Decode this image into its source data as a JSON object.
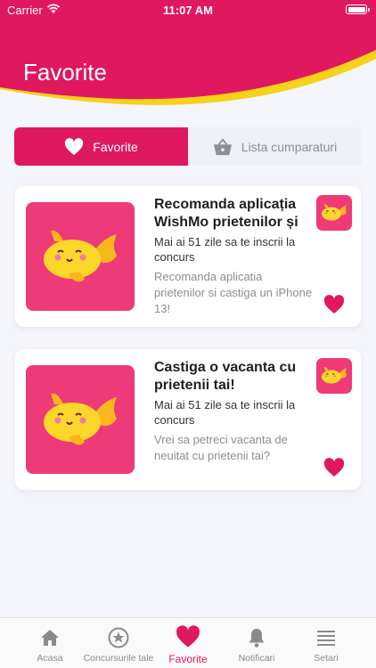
{
  "status_bar": {
    "carrier": "Carrier",
    "time": "11:07 AM"
  },
  "header": {
    "title": "Favorite"
  },
  "segments": [
    {
      "label": "Favorite",
      "icon": "heart-icon",
      "active": true
    },
    {
      "label": "Lista cumparaturi",
      "icon": "basket-icon",
      "active": false
    }
  ],
  "cards": [
    {
      "title": "Recomanda aplicația WishMo prietenilor și ...",
      "deadline": "Mai ai 51 zile sa te inscrii la concurs",
      "description": "Recomanda aplicatia prietenilor si castiga un iPhone 13!"
    },
    {
      "title": "Castiga o vacanta cu prietenii tai!",
      "deadline": "Mai ai 51 zile sa te inscrii la concurs",
      "description": "Vrei sa petreci vacanta de neuitat cu prietenii tai?"
    }
  ],
  "tabbar": [
    {
      "label": "Acasa",
      "icon": "home-icon"
    },
    {
      "label": "Concursurile tale",
      "icon": "star-circle-icon"
    },
    {
      "label": "Favorite",
      "icon": "heart-icon",
      "active": true
    },
    {
      "label": "Notificari",
      "icon": "bell-icon"
    },
    {
      "label": "Setari",
      "icon": "menu-icon"
    }
  ],
  "colors": {
    "brand": "#e0185f",
    "accent_yellow": "#f7d11a",
    "thumb": "#ee3a78"
  }
}
